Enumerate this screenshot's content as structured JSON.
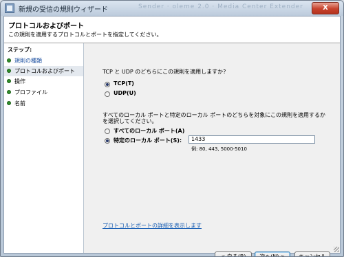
{
  "window": {
    "title": "新規の受信の規則ウィザード",
    "background_text": "Sender · oleme 2.0 · Media Center Extender",
    "close_label": "X"
  },
  "header": {
    "title": "プロトコルおよびポート",
    "description": "この規則を適用するプロトコルとポートを指定してください。"
  },
  "steps": {
    "heading": "ステップ:",
    "items": [
      {
        "label": "規則の種類",
        "state": "done"
      },
      {
        "label": "プロトコルおよびポート",
        "state": "current"
      },
      {
        "label": "操作",
        "state": "done"
      },
      {
        "label": "プロファイル",
        "state": "done"
      },
      {
        "label": "名前",
        "state": "done"
      }
    ]
  },
  "protocol": {
    "question": "TCP と UDP のどちらにこの規則を適用しますか?",
    "options": [
      {
        "label": "TCP(T)",
        "selected": true
      },
      {
        "label": "UDP(U)",
        "selected": false
      }
    ]
  },
  "ports": {
    "question": "すべてのローカル ポートと特定のローカル ポートのどちらを対象にこの規則を適用するかを選択してください。",
    "options": [
      {
        "label": "すべてのローカル ポート(A)",
        "selected": false
      },
      {
        "label": "特定のローカル ポート(S):",
        "selected": true
      }
    ],
    "input_value": "1433",
    "example": "例: 80, 443, 5000-5010"
  },
  "link": "プロトコルとポートの詳細を表示します",
  "buttons": {
    "back": "< 戻る(B)",
    "next": "次へ(N) >",
    "cancel": "キャンセル"
  },
  "colors": {
    "accent_link": "#1a5fb4",
    "step_dot": "#2f8f2a"
  }
}
